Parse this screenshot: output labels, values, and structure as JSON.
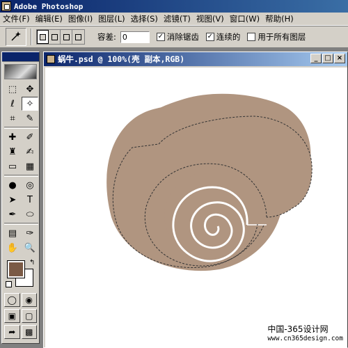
{
  "app": {
    "title": "Adobe Photoshop"
  },
  "menu": [
    "文件(F)",
    "编辑(E)",
    "图像(I)",
    "图层(L)",
    "选择(S)",
    "滤镜(T)",
    "视图(V)",
    "窗口(W)",
    "帮助(H)"
  ],
  "options": {
    "tool_icon": "magic-wand-icon",
    "tolerance_label": "容差:",
    "tolerance_value": "0",
    "antialias_label": "消除锯齿",
    "antialias_checked": true,
    "contiguous_label": "连续的",
    "contiguous_checked": true,
    "all_layers_label": "用于所有图层",
    "all_layers_checked": false
  },
  "document": {
    "title": "蜗牛.psd @ 100%(壳 副本,RGB)",
    "min_button": "_",
    "max_button": "□",
    "close_button": "×"
  },
  "toolbox": {
    "tools": [
      {
        "name": "marquee-icon",
        "glyph": "⬚"
      },
      {
        "name": "move-icon",
        "glyph": "✥"
      },
      {
        "name": "lasso-icon",
        "glyph": "ℓ"
      },
      {
        "name": "magic-wand-icon",
        "glyph": "✧",
        "active": true
      },
      {
        "name": "crop-icon",
        "glyph": "⌗"
      },
      {
        "name": "slice-icon",
        "glyph": "✎"
      },
      {
        "name": "healing-brush-icon",
        "glyph": "✚"
      },
      {
        "name": "brush-icon",
        "glyph": "✐"
      },
      {
        "name": "clone-stamp-icon",
        "glyph": "♜"
      },
      {
        "name": "history-brush-icon",
        "glyph": "✍"
      },
      {
        "name": "eraser-icon",
        "glyph": "▭"
      },
      {
        "name": "gradient-icon",
        "glyph": "▦"
      },
      {
        "name": "blur-icon",
        "glyph": "●"
      },
      {
        "name": "dodge-icon",
        "glyph": "◎"
      },
      {
        "name": "path-select-icon",
        "glyph": "➤"
      },
      {
        "name": "type-icon",
        "glyph": "T"
      },
      {
        "name": "pen-icon",
        "glyph": "✒"
      },
      {
        "name": "ellipse-shape-icon",
        "glyph": "⬭"
      },
      {
        "name": "notes-icon",
        "glyph": "▤"
      },
      {
        "name": "eyedropper-icon",
        "glyph": "✑"
      },
      {
        "name": "hand-icon",
        "glyph": "✋"
      },
      {
        "name": "zoom-icon",
        "glyph": "🔍"
      }
    ],
    "foreground_color": "#7a5a45",
    "background_color": "#ffffff"
  },
  "canvas": {
    "shell_color": "#b09580",
    "spiral_color": "#ffffff"
  },
  "watermark": {
    "line1": "中国-365设计网",
    "line2": "www.cn365design.com"
  }
}
